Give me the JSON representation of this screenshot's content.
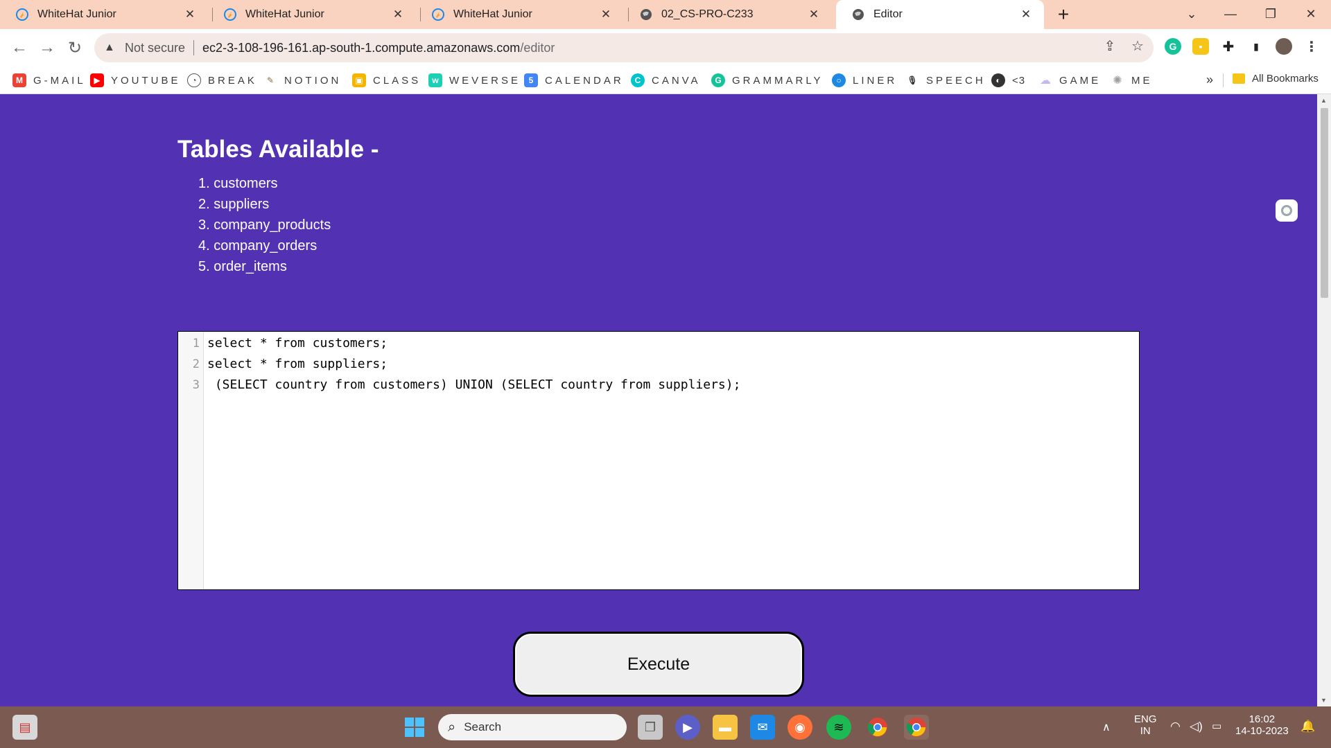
{
  "browser": {
    "tabs": [
      {
        "title": "WhiteHat Junior",
        "icon": "whitehat-icon",
        "active": false
      },
      {
        "title": "WhiteHat Junior",
        "icon": "whitehat-icon",
        "active": false
      },
      {
        "title": "WhiteHat Junior",
        "icon": "whitehat-icon",
        "active": false
      },
      {
        "title": "02_CS-PRO-C233",
        "icon": "globe-icon",
        "active": false
      },
      {
        "title": "Editor",
        "icon": "globe-icon",
        "active": true
      }
    ],
    "address": {
      "security_label": "Not secure",
      "url_host": "ec2-3-108-196-161.ap-south-1.compute.amazonaws.com",
      "url_path": "/editor"
    },
    "bookmarks": [
      {
        "label": "G-MAIL",
        "icon": "gmail-icon",
        "color": "#ea4335"
      },
      {
        "label": "YOUTUBE",
        "icon": "youtube-icon",
        "color": "#ff0000"
      },
      {
        "label": "BREAK",
        "icon": "clock-icon",
        "color": "#777777"
      },
      {
        "label": "NOTION",
        "icon": "pen-icon",
        "color": "#8a6d3b"
      },
      {
        "label": "CLASS",
        "icon": "classroom-icon",
        "color": "#f4b400"
      },
      {
        "label": "WEVERSE",
        "icon": "weverse-icon",
        "color": "#1ecfb5"
      },
      {
        "label": "CALENDAR",
        "icon": "calendar-icon",
        "color": "#4285f4"
      },
      {
        "label": "CANVA",
        "icon": "canva-icon",
        "color": "#00c4cc"
      },
      {
        "label": "GRAMMARLY",
        "icon": "grammarly-icon",
        "color": "#15c39a"
      },
      {
        "label": "LINER",
        "icon": "liner-icon",
        "color": "#1e88e5"
      },
      {
        "label": "SPEECH",
        "icon": "microphone-icon",
        "color": "#333333"
      },
      {
        "label": "<3",
        "icon": "globe-icon",
        "color": "#333333"
      },
      {
        "label": "GAME",
        "icon": "cloud-icon",
        "color": "#c7b8f0"
      },
      {
        "label": "ME",
        "icon": "sparkle-icon",
        "color": "#9e9e9e"
      }
    ],
    "overflow_label": "»",
    "all_bookmarks_label": "All Bookmarks"
  },
  "page": {
    "title": "Tables Available -",
    "tables": [
      "1. customers",
      "2. suppliers",
      "3. company_products",
      "4. company_orders",
      "5. order_items"
    ],
    "editor": {
      "line_numbers": [
        "1",
        "2",
        "3"
      ],
      "lines": [
        "select * from customers;",
        "select * from suppliers;",
        " (SELECT country from customers) UNION (SELECT country from suppliers);"
      ]
    },
    "execute_label": "Execute"
  },
  "taskbar": {
    "search_placeholder": "Search",
    "language": "ENG",
    "region": "IN",
    "time": "16:02",
    "date": "14-10-2023"
  },
  "colors": {
    "page_background": "#5232b2",
    "tab_strip": "#f9d2c0",
    "taskbar": "#7b5a52"
  }
}
